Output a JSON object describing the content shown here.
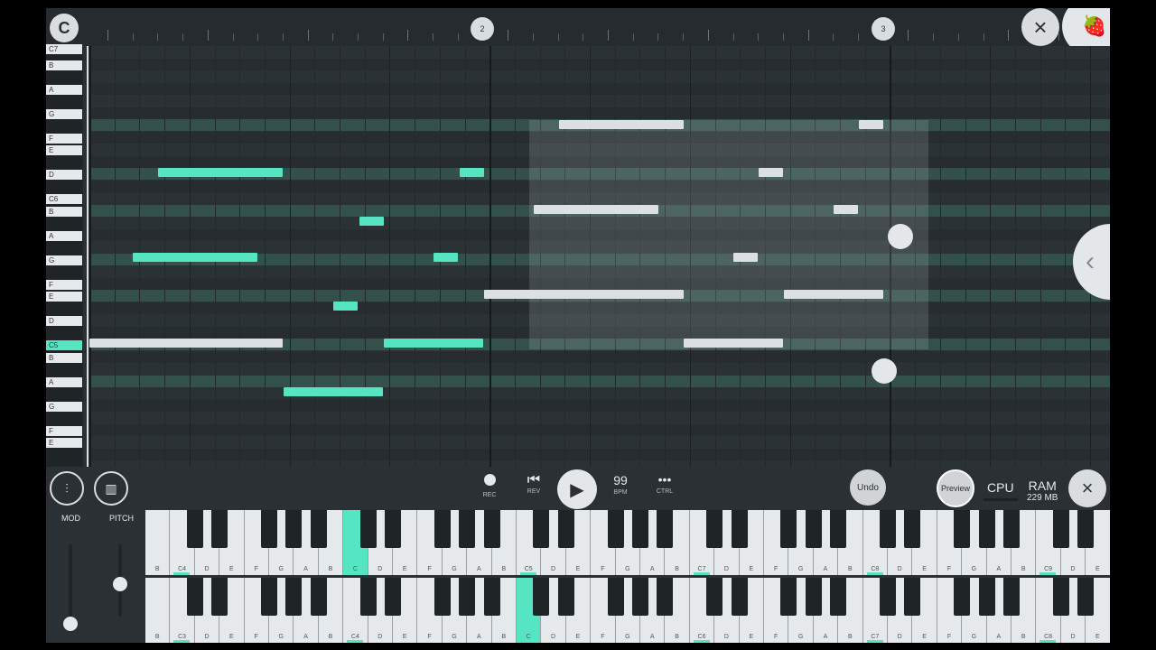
{
  "ruler": {
    "logo_glyph": "C",
    "bar_markers": [
      "2",
      "3"
    ],
    "close_icon": "close-icon",
    "fl_logo_icon": "fruit-logo-icon"
  },
  "piano_roll_keys": [
    {
      "label": "C7",
      "c": false
    },
    {
      "label": "B",
      "c": false
    },
    {
      "label": "A",
      "c": false
    },
    {
      "label": "G",
      "c": false
    },
    {
      "label": "F",
      "c": false
    },
    {
      "label": "E",
      "c": false
    },
    {
      "label": "D",
      "c": false
    },
    {
      "label": "C6",
      "c": false
    },
    {
      "label": "B",
      "c": false
    },
    {
      "label": "A",
      "c": false
    },
    {
      "label": "G",
      "c": false
    },
    {
      "label": "F",
      "c": false
    },
    {
      "label": "E",
      "c": false
    },
    {
      "label": "D",
      "c": false
    },
    {
      "label": "C5",
      "c": true
    },
    {
      "label": "B",
      "c": false
    },
    {
      "label": "A",
      "c": false
    },
    {
      "label": "G",
      "c": false
    },
    {
      "label": "F",
      "c": false
    },
    {
      "label": "E",
      "c": false
    }
  ],
  "transport": {
    "rec_label": "REC",
    "rev_label": "REV",
    "bpm_value": "99",
    "bpm_label": "BPM",
    "ctrl_label": "CTRL",
    "ctrl_glyph": "•••",
    "undo_label": "Undo",
    "preview_label": "Preview",
    "cpu_label": "CPU",
    "ram_label": "RAM",
    "ram_value": "229 MB"
  },
  "controls": {
    "mod_label": "MOD",
    "pitch_label": "PITCH",
    "mod_level": 0.0,
    "pitch_level": 0.5
  },
  "keyboard_upper": {
    "octave_labels": [
      "C4",
      "C5",
      "C6",
      "C7",
      "C8",
      "C9"
    ],
    "note_letters": [
      "B",
      "C4",
      "D",
      "E",
      "F",
      "G",
      "A",
      "B",
      "C",
      "D",
      "E",
      "F",
      "G",
      "A",
      "B",
      "C5",
      "D",
      "E",
      "F",
      "G",
      "A",
      "B",
      "C7",
      "D",
      "E",
      "F",
      "G",
      "A",
      "B",
      "C8",
      "D",
      "E",
      "F",
      "G",
      "A",
      "B",
      "C9",
      "D",
      "E"
    ]
  },
  "keyboard_lower": {
    "note_letters": [
      "B",
      "C3",
      "D",
      "E",
      "F",
      "G",
      "A",
      "B",
      "C4",
      "D",
      "E",
      "F",
      "G",
      "A",
      "B",
      "C",
      "D",
      "E",
      "F",
      "G",
      "A",
      "B",
      "C6",
      "D",
      "E",
      "F",
      "G",
      "A",
      "B",
      "C7",
      "D",
      "E",
      "F",
      "G",
      "A",
      "B",
      "C8",
      "D",
      "E"
    ]
  },
  "colors": {
    "accent": "#56e5c3",
    "note_white": "#dde0e2",
    "background": "#2a3033"
  }
}
